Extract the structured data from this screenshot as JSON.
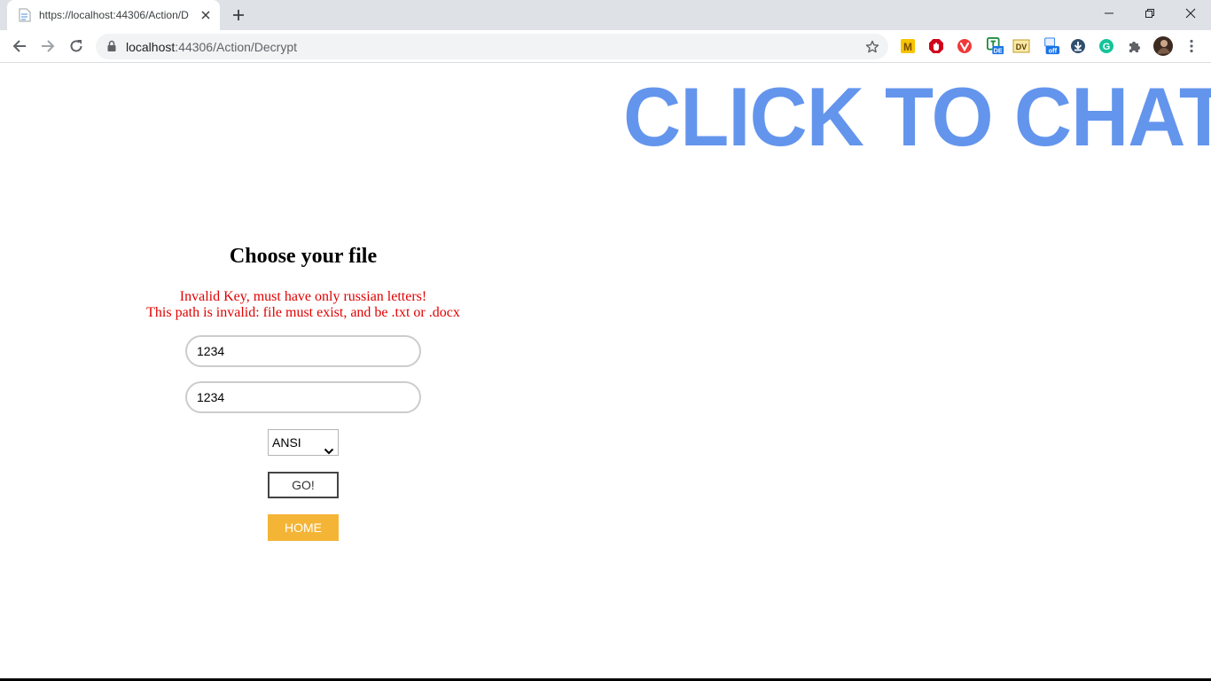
{
  "browser": {
    "tab_title": "https://localhost:44306/Action/D",
    "url_host": "localhost",
    "url_path": ":44306/Action/Decrypt",
    "extensions": [
      "mega-icon",
      "adblock-icon",
      "vivaldi-icon",
      "translate-de-icon",
      "dv-icon",
      "turn-off-icon",
      "download-icon",
      "grammarly-icon",
      "puzzle-icon",
      "profile-avatar"
    ],
    "ext_labels": {
      "mega": "M",
      "dv": "DV",
      "de": "DE",
      "off": "off",
      "grammarly": "G"
    }
  },
  "banner": {
    "text": "CLICK TO CHAT",
    "color": "#6495ed"
  },
  "form": {
    "title": "Choose your file",
    "errors": [
      "Invalid Key, must have only russian letters!",
      "This path is invalid: file must exist, and be .txt or .docx"
    ],
    "key_value": "1234",
    "path_value": "1234",
    "encoding_selected": "ANSI",
    "go_label": "GO!",
    "home_label": "HOME",
    "home_color": "#f4b536",
    "error_color": "#e00000"
  }
}
